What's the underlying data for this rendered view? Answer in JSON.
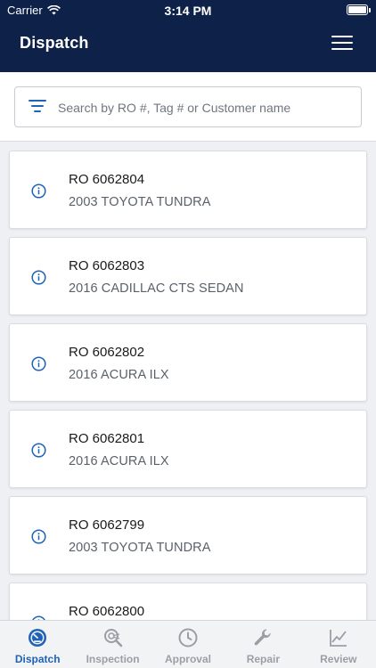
{
  "status_bar": {
    "carrier": "Carrier",
    "time": "3:14 PM"
  },
  "nav": {
    "title": "Dispatch",
    "menu_icon": "hamburger-menu-icon"
  },
  "search": {
    "placeholder": "Search by RO #, Tag # or Customer name",
    "value": "",
    "filter_icon": "filter-icon"
  },
  "orders": [
    {
      "ro": "RO 6062804",
      "vehicle": "2003 TOYOTA TUNDRA"
    },
    {
      "ro": "RO 6062803",
      "vehicle": "2016 CADILLAC CTS SEDAN"
    },
    {
      "ro": "RO 6062802",
      "vehicle": "2016 ACURA ILX"
    },
    {
      "ro": "RO 6062801",
      "vehicle": "2016 ACURA ILX"
    },
    {
      "ro": "RO 6062799",
      "vehicle": "2003 TOYOTA TUNDRA"
    },
    {
      "ro": "RO 6062800",
      "vehicle": ""
    }
  ],
  "tabs": [
    {
      "label": "Dispatch",
      "icon": "dashboard-gauge-icon",
      "active": true
    },
    {
      "label": "Inspection",
      "icon": "inspection-search-icon",
      "active": false
    },
    {
      "label": "Approval",
      "icon": "clock-icon",
      "active": false
    },
    {
      "label": "Repair",
      "icon": "wrench-icon",
      "active": false
    },
    {
      "label": "Review",
      "icon": "line-chart-icon",
      "active": false
    }
  ],
  "colors": {
    "header_bg": "#0e2249",
    "accent": "#1f63b6",
    "inactive": "#9a9fa6"
  }
}
